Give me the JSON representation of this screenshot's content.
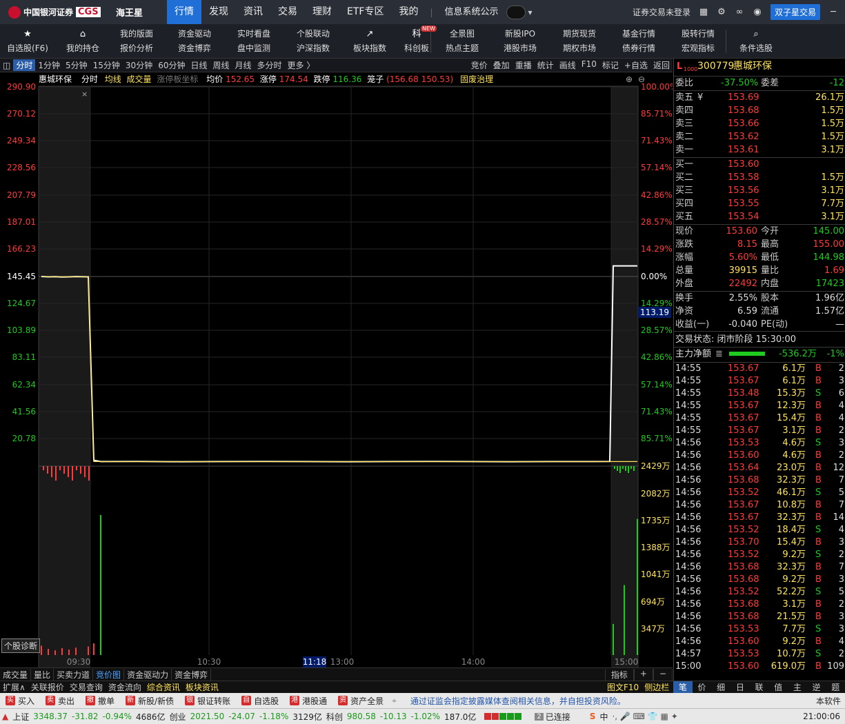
{
  "topbar": {
    "brand": "中国银河证券",
    "brand_code": "CGS",
    "app_name": "海王星",
    "nav": [
      "行情",
      "发现",
      "资讯",
      "交易",
      "理财",
      "ETF专区",
      "我的"
    ],
    "nav_active": 0,
    "notice": "信息系统公示",
    "user_status": "证券交易未登录",
    "trade_button": "双子星交易"
  },
  "toolbar": {
    "items": [
      {
        "top": "",
        "bottom": "自选股(F6)",
        "icon": "star-icon"
      },
      {
        "top": "",
        "bottom": "我的持仓",
        "icon": "house-icon"
      },
      {
        "top": "我的版面",
        "bottom": "报价分析"
      },
      {
        "top": "资金驱动",
        "bottom": "资金博弈"
      },
      {
        "top": "实时看盘",
        "bottom": "盘中监测"
      },
      {
        "top": "个股联动",
        "bottom": "沪深指数"
      },
      {
        "top": "",
        "bottom": "板块指数",
        "icon": "chart-line-icon"
      },
      {
        "top": "",
        "bottom": "科创板",
        "icon": "kechuang-icon",
        "badge": "NEW"
      },
      {
        "top": "全景图",
        "bottom": "热点主题"
      },
      {
        "top": "新股IPO",
        "bottom": "港股市场"
      },
      {
        "top": "期货现货",
        "bottom": "期权市场"
      },
      {
        "top": "基金行情",
        "bottom": "债券行情"
      },
      {
        "top": "股转行情",
        "bottom": "宏观指标"
      },
      {
        "top": "",
        "bottom": "条件选股",
        "icon": "search-chart-icon"
      }
    ]
  },
  "periods": [
    "分时",
    "1分钟",
    "5分钟",
    "15分钟",
    "30分钟",
    "60分钟",
    "日线",
    "周线",
    "月线",
    "多分时",
    "更多 〉"
  ],
  "period_active": 0,
  "chart_tools": [
    "竞价",
    "叠加",
    "重播",
    "统计",
    "画线",
    "F10",
    "标记",
    "+自选",
    "返回"
  ],
  "chart_info": {
    "name": "惠城环保",
    "mode": "分时",
    "avg_label": "均线",
    "vol_label": "成交量",
    "limit_label": "涨停板坐标",
    "avg_price_label": "均价",
    "avg_price": "152.65",
    "limit_up_label": "涨停",
    "limit_up": "174.54",
    "limit_down_label": "跌停",
    "limit_down": "116.36",
    "cage_label": "笼子",
    "cage": "(156.68 150.53)",
    "tag": "固废治理"
  },
  "chart_data": {
    "type": "line",
    "title": "惠城环保 分时",
    "ylim": [
      0,
      290.9
    ],
    "y_ticks_left": [
      "290.90",
      "270.12",
      "249.34",
      "228.56",
      "207.79",
      "187.01",
      "166.23",
      "145.45",
      "124.67",
      "103.89",
      "83.11",
      "62.34",
      "41.56",
      "20.78"
    ],
    "y_ticks_right": [
      "100.00%",
      "85.71%",
      "71.43%",
      "57.14%",
      "42.86%",
      "28.57%",
      "14.29%",
      "0.00%",
      "14.29%",
      "28.57%",
      "42.86%",
      "57.14%",
      "71.43%",
      "85.71%"
    ],
    "vol_ticks": [
      "2429万",
      "2082万",
      "1735万",
      "1388万",
      "1041万",
      "694万",
      "347万"
    ],
    "x_ticks": [
      "09:30",
      "10:30",
      "11:18",
      "13:00",
      "14:00",
      "15:00"
    ],
    "crosshair_price": "113.19",
    "crosshair_time": "11:18",
    "series": [
      {
        "name": "价格",
        "values": [
          145.45,
          145.2,
          145.3,
          145.1,
          145.2,
          145.4,
          145.2,
          4.5,
          3.5,
          3.6,
          3.4,
          3.5,
          3.6,
          3.5,
          3.4,
          3.5,
          3.6,
          3.5,
          3.4,
          3.5,
          3.5,
          3.6,
          153.6,
          153.6,
          153.6
        ]
      },
      {
        "name": "均价",
        "values": [
          145.45,
          145.3,
          145.3,
          145.2,
          145.2,
          145.3,
          145.3,
          3.5,
          3.5,
          3.5,
          3.5,
          3.5,
          3.5,
          3.5,
          3.5,
          3.5,
          3.5,
          3.5,
          3.5,
          3.5,
          3.5,
          3.5,
          3.5,
          3.5,
          3.5
        ]
      }
    ],
    "volume": [
      120,
      80,
      60,
      90,
      70,
      95,
      110,
      150,
      1800,
      0,
      0,
      0,
      0,
      0,
      0,
      0,
      0,
      0,
      0,
      0,
      0,
      0,
      400,
      900,
      1750
    ]
  },
  "bottom_tabs": [
    "成交量",
    "量比",
    "买卖力道",
    "竞价图",
    "资金驱动力",
    "资金博弈"
  ],
  "bottom_tab_active": 3,
  "bottom_right": [
    "指标",
    "+",
    "−"
  ],
  "row2_tabs": [
    "扩展∧",
    "关联报价",
    "交易查询",
    "资金流向",
    "综合资讯",
    "板块资讯"
  ],
  "row2_right": [
    "图文F10",
    "侧边栏《"
  ],
  "diag_button": "个股诊断",
  "right": {
    "code": "300779",
    "name": "惠城环保",
    "tag": "L",
    "tag_sub": "1000",
    "wb_label": "委比",
    "wb": "-37.50%",
    "wc_label": "委差",
    "wc": "-12",
    "sells": [
      {
        "label": "卖五",
        "price": "153.69",
        "vol": "26.1万",
        "yen": "¥"
      },
      {
        "label": "卖四",
        "price": "153.68",
        "vol": "1.5万"
      },
      {
        "label": "卖三",
        "price": "153.66",
        "vol": "1.5万"
      },
      {
        "label": "卖二",
        "price": "153.62",
        "vol": "1.5万"
      },
      {
        "label": "卖一",
        "price": "153.61",
        "vol": "3.1万"
      }
    ],
    "buys": [
      {
        "label": "买一",
        "price": "153.60",
        "vol": ""
      },
      {
        "label": "买二",
        "price": "153.58",
        "vol": "1.5万"
      },
      {
        "label": "买三",
        "price": "153.56",
        "vol": "3.1万"
      },
      {
        "label": "买四",
        "price": "153.55",
        "vol": "7.7万"
      },
      {
        "label": "买五",
        "price": "153.54",
        "vol": "3.1万"
      }
    ],
    "stats1": [
      {
        "l1": "现价",
        "v1": "153.60",
        "c1": "red",
        "l2": "今开",
        "v2": "145.00",
        "c2": "grn"
      },
      {
        "l1": "涨跌",
        "v1": "8.15",
        "c1": "red",
        "l2": "最高",
        "v2": "155.00",
        "c2": "red"
      },
      {
        "l1": "涨幅",
        "v1": "5.60%",
        "c1": "red",
        "l2": "最低",
        "v2": "144.98",
        "c2": "grn"
      },
      {
        "l1": "总量",
        "v1": "39915",
        "c1": "yel",
        "l2": "量比",
        "v2": "1.69",
        "c2": "red"
      },
      {
        "l1": "外盘",
        "v1": "22492",
        "c1": "red",
        "l2": "内盘",
        "v2": "17423",
        "c2": "grn"
      }
    ],
    "stats2": [
      {
        "l1": "换手",
        "v1": "2.55%",
        "l2": "股本",
        "v2": "1.96亿"
      },
      {
        "l1": "净资",
        "v1": "6.59",
        "l2": "流通",
        "v2": "1.57亿"
      },
      {
        "l1": "收益(一)",
        "v1": "-0.040",
        "l2": "PE(动)",
        "v2": "—"
      }
    ],
    "status": "交易状态: 闭市阶段 15:30:00",
    "flow_label": "主力净额",
    "flow_value": "-536.2万",
    "flow_pct": "-1%",
    "ticks": [
      {
        "t": "14:55",
        "p": "153.67",
        "v": "6.1万",
        "d": "B",
        "n": "2"
      },
      {
        "t": "14:55",
        "p": "153.67",
        "v": "6.1万",
        "d": "B",
        "n": "3"
      },
      {
        "t": "14:55",
        "p": "153.48",
        "v": "15.3万",
        "d": "S",
        "n": "6"
      },
      {
        "t": "14:55",
        "p": "153.67",
        "v": "12.3万",
        "d": "B",
        "n": "4"
      },
      {
        "t": "14:55",
        "p": "153.67",
        "v": "15.4万",
        "d": "B",
        "n": "4"
      },
      {
        "t": "14:55",
        "p": "153.67",
        "v": "3.1万",
        "d": "B",
        "n": "2"
      },
      {
        "t": "14:56",
        "p": "153.53",
        "v": "4.6万",
        "d": "S",
        "n": "3"
      },
      {
        "t": "14:56",
        "p": "153.60",
        "v": "4.6万",
        "d": "B",
        "n": "2"
      },
      {
        "t": "14:56",
        "p": "153.64",
        "v": "23.0万",
        "d": "B",
        "n": "12"
      },
      {
        "t": "14:56",
        "p": "153.68",
        "v": "32.3万",
        "d": "B",
        "n": "7"
      },
      {
        "t": "14:56",
        "p": "153.52",
        "v": "46.1万",
        "d": "S",
        "n": "5"
      },
      {
        "t": "14:56",
        "p": "153.67",
        "v": "10.8万",
        "d": "B",
        "n": "7"
      },
      {
        "t": "14:56",
        "p": "153.67",
        "v": "32.3万",
        "d": "B",
        "n": "14"
      },
      {
        "t": "14:56",
        "p": "153.52",
        "v": "18.4万",
        "d": "S",
        "n": "4"
      },
      {
        "t": "14:56",
        "p": "153.70",
        "v": "15.4万",
        "d": "B",
        "n": "3"
      },
      {
        "t": "14:56",
        "p": "153.52",
        "v": "9.2万",
        "d": "S",
        "n": "2"
      },
      {
        "t": "14:56",
        "p": "153.68",
        "v": "32.3万",
        "d": "B",
        "n": "7"
      },
      {
        "t": "14:56",
        "p": "153.68",
        "v": "9.2万",
        "d": "B",
        "n": "3"
      },
      {
        "t": "14:56",
        "p": "153.52",
        "v": "52.2万",
        "d": "S",
        "n": "5"
      },
      {
        "t": "14:56",
        "p": "153.68",
        "v": "3.1万",
        "d": "B",
        "n": "2"
      },
      {
        "t": "14:56",
        "p": "153.68",
        "v": "21.5万",
        "d": "B",
        "n": "3"
      },
      {
        "t": "14:56",
        "p": "153.53",
        "v": "7.7万",
        "d": "S",
        "n": "3"
      },
      {
        "t": "14:56",
        "p": "153.60",
        "v": "9.2万",
        "d": "B",
        "n": "4"
      },
      {
        "t": "14:57",
        "p": "153.53",
        "v": "10.7万",
        "d": "S",
        "n": "2"
      },
      {
        "t": "15:00",
        "p": "153.60",
        "v": "619.0万",
        "d": "B",
        "n": "109"
      }
    ],
    "tabs": [
      "笔",
      "价",
      "细",
      "日",
      "联",
      "值",
      "主",
      "逆",
      "题"
    ],
    "tab_active": 0
  },
  "actions": [
    "买入",
    "卖出",
    "撤单",
    "新股/新债",
    "银证转账",
    "自选股",
    "港股通",
    "资产全景"
  ],
  "ticker": "通过证监会指定披露媒体查阅相关信息，并自担投资风险。",
  "status": {
    "sh_label": "上证",
    "sh": "3348.37",
    "sh_chg": "-31.82",
    "sh_pct": "-0.94%",
    "sh_amt": "4686亿",
    "cy_label": "创业",
    "cy": "2021.50",
    "cy_chg": "-24.07",
    "cy_pct": "-1.18%",
    "cy_amt": "3129亿",
    "kc_label": "科创",
    "kc": "980.58",
    "kc_chg": "-10.13",
    "kc_pct": "-1.02%",
    "kc_amt": "187.0亿",
    "conn_count": "2",
    "conn": "已连接",
    "ime": "中",
    "version": "本软件",
    "time": "21:00:06"
  },
  "colors": {
    "up": "#ff3b3b",
    "down": "#1ecb1e",
    "avg": "#ffe45c",
    "accent": "#1f6fd6"
  }
}
